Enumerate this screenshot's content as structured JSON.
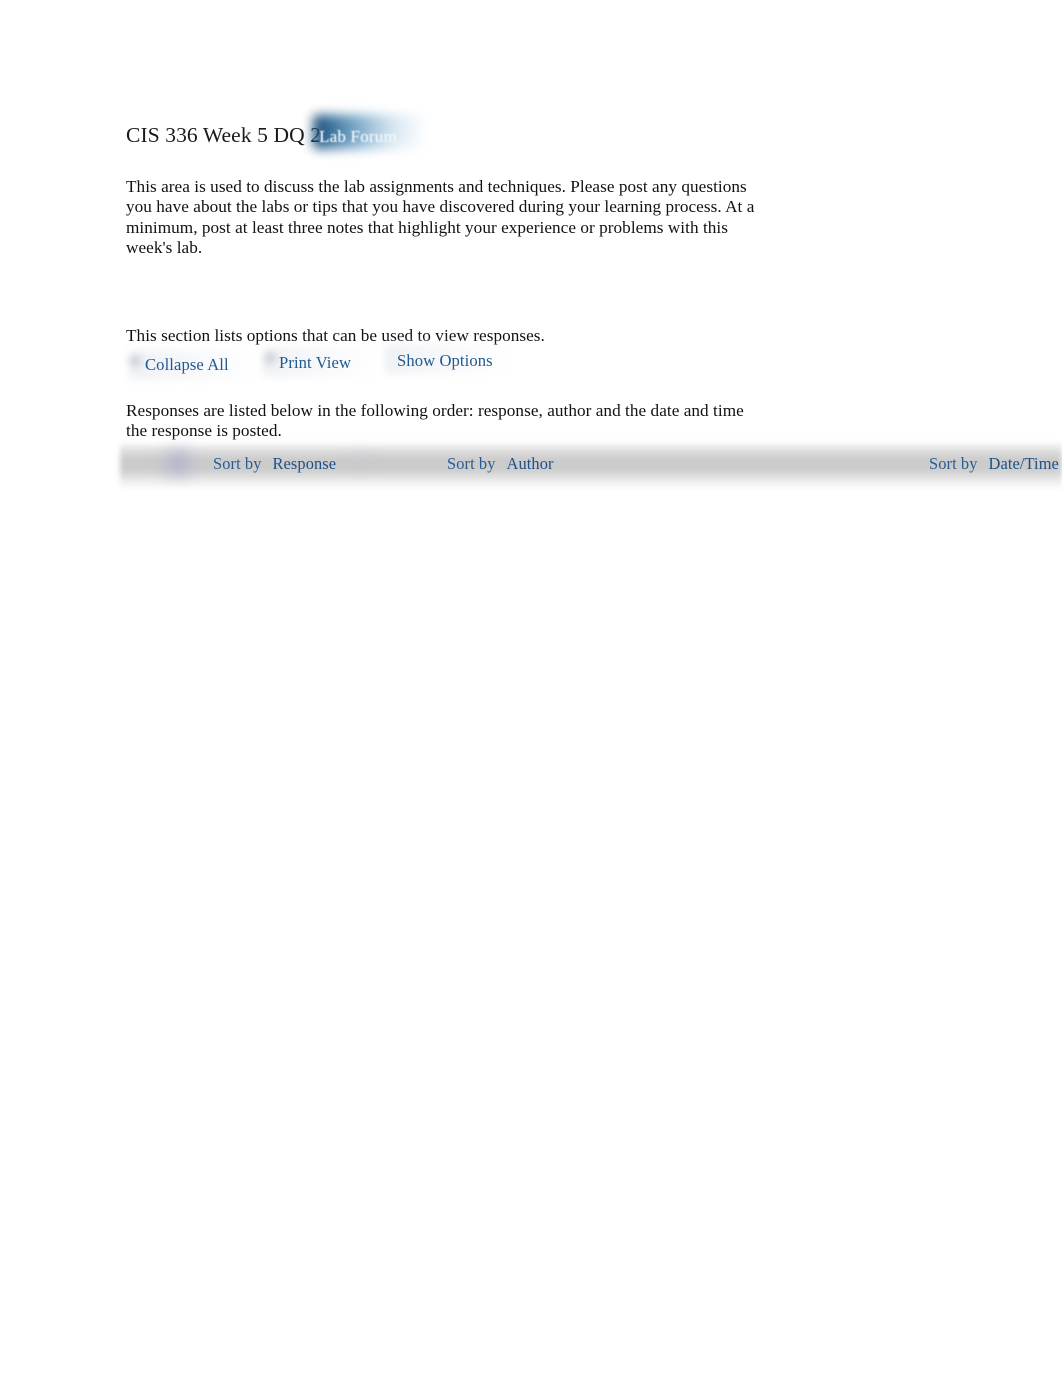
{
  "document": {
    "title": "CIS 336 Week 5 DQ 2",
    "badge_label": "Lab Forum"
  },
  "intro": {
    "text": "This area is used to discuss the lab assignments and techniques. Please post any questions you have about the labs or tips that you have discovered during your learning process. At a minimum, post at least three notes that highlight your experience or problems with this week's lab."
  },
  "options": {
    "intro_text": "This section lists options that can be used to view responses.",
    "links": [
      {
        "label": "Collapse All",
        "icon": "collapse-icon"
      },
      {
        "label": "Print View",
        "icon": "printer-icon"
      },
      {
        "label": "Show Options",
        "icon": "options-icon"
      }
    ]
  },
  "responses": {
    "order_text": "Responses are listed below in the following order: response, author and the date and time the response is posted.",
    "sort_bar": {
      "sort_by_label": "Sort by",
      "columns": [
        {
          "key_label": "Response"
        },
        {
          "key_label": "Author"
        },
        {
          "key_label": "Date/Time"
        }
      ]
    }
  },
  "colors": {
    "link_blue": "#215a92",
    "sort_blue": "#23558c",
    "badge_dark": "#0f3c68",
    "badge_light": "#f7fafc",
    "bar_grey": "#c9c9c9",
    "text_black": "#121212"
  }
}
